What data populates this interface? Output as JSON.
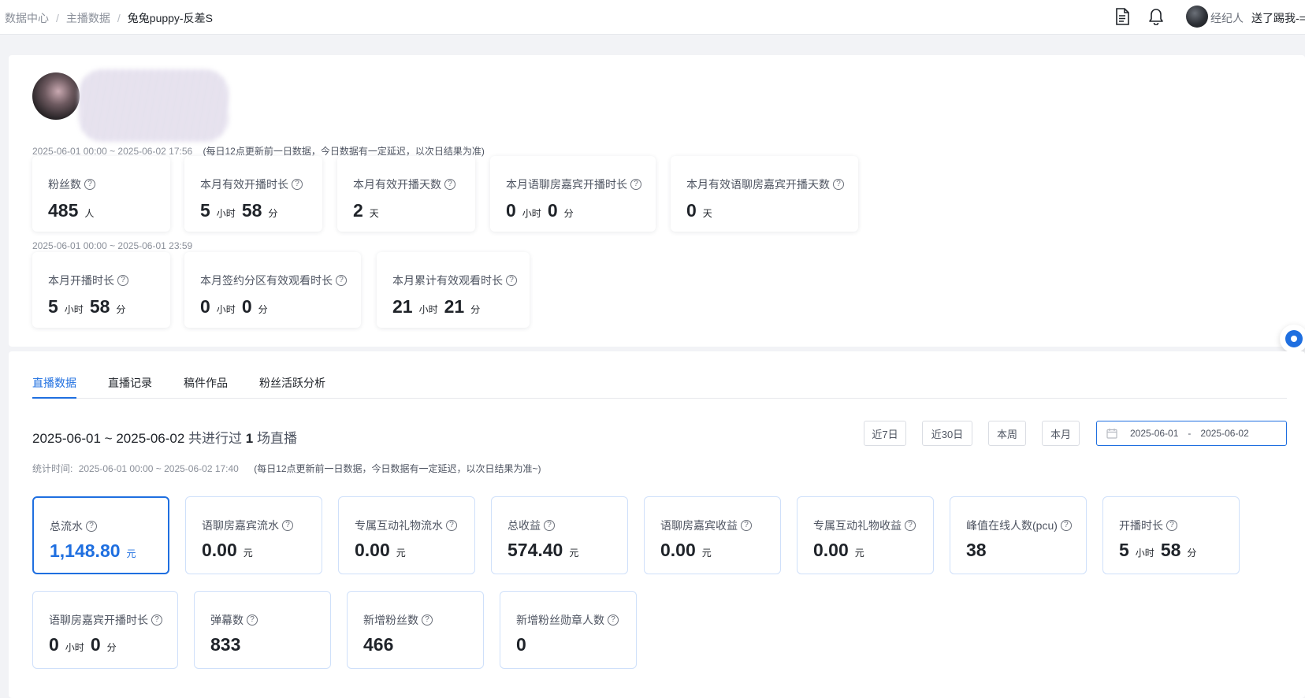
{
  "breadcrumb": [
    "数据中心",
    "主播数据",
    "兔兔puppy-反差S"
  ],
  "header": {
    "role": "经纪人",
    "user": "送了踢我-="
  },
  "profile": {
    "note1_range": "2025-06-01 00:00 ~ 2025-06-02 17:56",
    "note1_hint": "(每日12点更新前一日数据，今日数据有一定延迟，以次日结果为准)",
    "note2_range": "2025-06-01 00:00 ~ 2025-06-01 23:59"
  },
  "stats_row1": [
    {
      "label": "粉丝数",
      "v1": "485",
      "u1": "人"
    },
    {
      "label": "本月有效开播时长",
      "v1": "5",
      "u1": "小时",
      "v2": "58",
      "u2": "分"
    },
    {
      "label": "本月有效开播天数",
      "v1": "2",
      "u1": "天"
    },
    {
      "label": "本月语聊房嘉宾开播时长",
      "v1": "0",
      "u1": "小时",
      "v2": "0",
      "u2": "分"
    },
    {
      "label": "本月有效语聊房嘉宾开播天数",
      "v1": "0",
      "u1": "天"
    }
  ],
  "stats_row2": [
    {
      "label": "本月开播时长",
      "v1": "5",
      "u1": "小时",
      "v2": "58",
      "u2": "分"
    },
    {
      "label": "本月签约分区有效观看时长",
      "v1": "0",
      "u1": "小时",
      "v2": "0",
      "u2": "分"
    },
    {
      "label": "本月累计有效观看时长",
      "v1": "21",
      "u1": "小时",
      "v2": "21",
      "u2": "分"
    }
  ],
  "tabs": [
    "直播数据",
    "直播记录",
    "稿件作品",
    "粉丝活跃分析"
  ],
  "summary": {
    "range": "2025-06-01 ~ 2025-06-02",
    "mid": "共进行过",
    "count": "1",
    "suffix": "场直播"
  },
  "stat_time": {
    "label": "统计时间:",
    "range": "2025-06-01 00:00 ~ 2025-06-02 17:40",
    "hint": "(每日12点更新前一日数据，今日数据有一定延迟，以次日结果为准~)"
  },
  "range_buttons": [
    "近7日",
    "近30日",
    "本周",
    "本月"
  ],
  "date_picker": {
    "start": "2025-06-01",
    "sep": "-",
    "end": "2025-06-02"
  },
  "kpis_row1": [
    {
      "label": "总流水",
      "v1": "1,148.80",
      "u1": "元"
    },
    {
      "label": "语聊房嘉宾流水",
      "v1": "0.00",
      "u1": "元"
    },
    {
      "label": "专属互动礼物流水",
      "v1": "0.00",
      "u1": "元"
    },
    {
      "label": "总收益",
      "v1": "574.40",
      "u1": "元"
    },
    {
      "label": "语聊房嘉宾收益",
      "v1": "0.00",
      "u1": "元"
    },
    {
      "label": "专属互动礼物收益",
      "v1": "0.00",
      "u1": "元"
    },
    {
      "label": "峰值在线人数(pcu)",
      "v1": "38"
    },
    {
      "label": "开播时长",
      "v1": "5",
      "u1": "小时",
      "v2": "58",
      "u2": "分"
    }
  ],
  "kpis_row2": [
    {
      "label": "语聊房嘉宾开播时长",
      "v1": "0",
      "u1": "小时",
      "v2": "0",
      "u2": "分"
    },
    {
      "label": "弹幕数",
      "v1": "833"
    },
    {
      "label": "新增粉丝数",
      "v1": "466"
    },
    {
      "label": "新增粉丝勋章人数",
      "v1": "0"
    }
  ],
  "colors": {
    "accent": "#1f6fe0",
    "page_bg": "#f2f3f6",
    "card_border": "#cfe0fa"
  }
}
